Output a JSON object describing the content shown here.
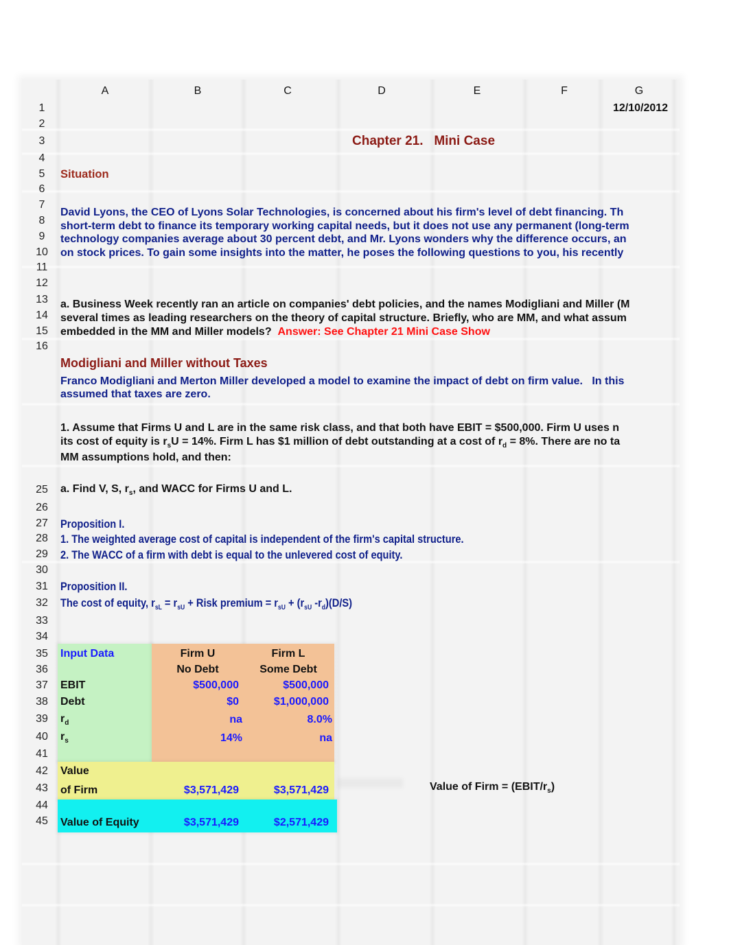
{
  "sheet": {
    "columns": [
      "A",
      "B",
      "C",
      "D",
      "E",
      "F",
      "G"
    ],
    "row_numbers_top": [
      "1",
      "2",
      "3",
      "4",
      "5",
      "6",
      "7",
      "8",
      "9",
      "10",
      "11",
      "12",
      "13",
      "14",
      "15",
      "16"
    ],
    "row_numbers_bottom": [
      "25",
      "26",
      "27",
      "28",
      "29",
      "30",
      "31",
      "32",
      "33",
      "34",
      "35",
      "36",
      "37",
      "38",
      "39",
      "40",
      "41",
      "42",
      "43",
      "44",
      "45"
    ]
  },
  "header": {
    "date": "12/10/2012",
    "title": "Chapter 21.   Mini Case",
    "situation_label": "Situation"
  },
  "situation": {
    "lines": [
      "David Lyons, the CEO of Lyons Solar Technologies, is concerned about his firm's level of debt financing.  Th",
      "short-term debt to finance its temporary working capital needs, but it does not use any permanent (long-term",
      "technology companies average about 30 percent debt, and Mr. Lyons wonders why the difference occurs, an",
      "on stock prices.  To gain some insights into the matter, he poses the following questions to you, his recently"
    ]
  },
  "question_a": {
    "lines": [
      "a.  Business Week recently ran an article on companies' debt policies, and the names Modigliani and Miller (M",
      "several times as leading researchers on the theory of capital structure.  Briefly, who are MM, and what assum",
      "embedded in the MM and Miller models?"
    ],
    "answer": "Answer: See Chapter 21 Mini Case Show"
  },
  "mm_no_taxes": {
    "heading": "Modigliani and Miller without Taxes",
    "intro_lines": [
      "Franco Modigliani and Merton Miller developed a model to examine the impact of debt on firm value.   In this",
      "assumed that taxes are zero."
    ]
  },
  "question_1": {
    "line1": "1.  Assume that Firms U and L are in the same risk class, and that both have EBIT = $500,000.  Firm U uses n",
    "line2_pre": "its cost of equity is r",
    "line2_sub1": "s",
    "line2_mid": "U = 14%.  Firm L has $1 million of debt outstanding at a cost of r",
    "line2_sub2": "d",
    "line2_post": " = 8%.  There are no ta",
    "line3": "MM assumptions hold, and then:",
    "part_a_pre": "a.  Find V, S, r",
    "part_a_sub": "s",
    "part_a_post": ", and WACC for Firms U and L."
  },
  "propositions": {
    "p1_title": "Proposition I.",
    "p1_item1": "1.  The weighted average cost of capital is independent of the firm's capital structure.",
    "p1_item2": "2.  The WACC of a firm with debt is equal to the unlevered cost of equity.",
    "p2_title": "Proposition II.",
    "p2_pre": "The cost of equity, r",
    "p2_sub1": "sL",
    "p2_t1": " = r",
    "p2_sub2": "sU",
    "p2_t2": " + Risk premium = r",
    "p2_sub3": "sU",
    "p2_t3": " + (r",
    "p2_sub4": "sU",
    "p2_t4": " -r",
    "p2_sub5": "d",
    "p2_t5": ")(D/S)"
  },
  "input_table": {
    "label": "Input Data",
    "firm_u": {
      "name": "Firm U",
      "sub": "No Debt"
    },
    "firm_l": {
      "name": "Firm L",
      "sub": "Some Debt"
    },
    "rows": {
      "ebit": {
        "label": "EBIT",
        "u": "$500,000",
        "l": "$500,000"
      },
      "debt": {
        "label": "Debt",
        "u": "$0",
        "l": "$1,000,000"
      },
      "rd": {
        "label": "r",
        "sub": "d",
        "u": "na",
        "l": "8.0%"
      },
      "rs": {
        "label": "r",
        "sub": "s",
        "u": "14%",
        "l": "na"
      }
    },
    "value_of_firm": {
      "label1": "Value",
      "label2": "of Firm",
      "u": "$3,571,429",
      "l": "$3,571,429"
    },
    "value_of_equity": {
      "label": "Value of Equity",
      "u": "$3,571,429",
      "l": "$2,571,429"
    }
  },
  "formula_note": {
    "pre": "Value of Firm = (EBIT/r",
    "sub": "s",
    "post": ")"
  },
  "colors": {
    "navy_text": "#0f1f8a",
    "maroon_text": "#8b1a14",
    "answer_red": "#ff1010",
    "input_blue": "#1a1aff",
    "green_fill": "#c5f2c3",
    "orange_fill": "#f3c297",
    "yellow_fill": "#eff08f",
    "cyan_fill": "#12f0f0"
  }
}
